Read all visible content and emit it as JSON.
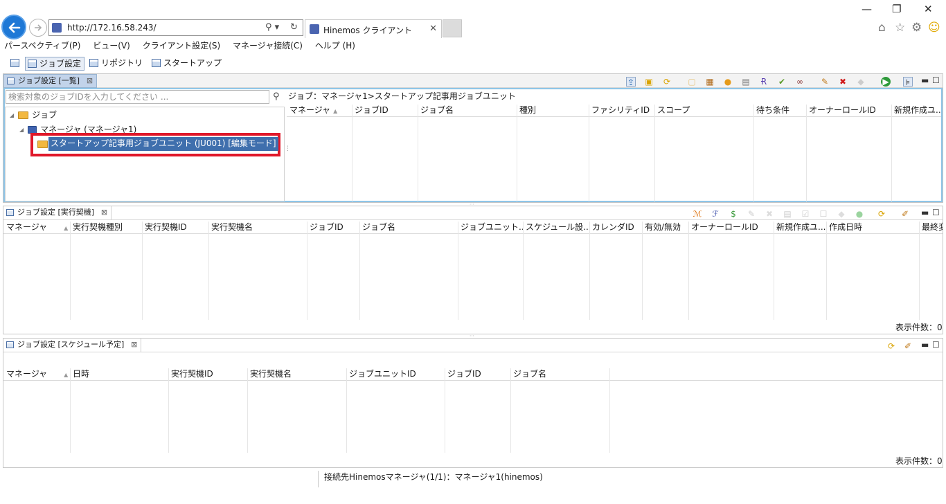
{
  "browser": {
    "url": "http://172.16.58.243/",
    "tab_title": "Hinemos クライアント",
    "search_glyph": "⚲ ▾",
    "refresh_glyph": "↻",
    "tab_close": "✕",
    "minimize": "—",
    "restore": "❐",
    "close": "✕",
    "home_glyph": "⌂",
    "star_glyph": "☆",
    "settings_glyph": "⚙",
    "smiley_glyph": "☺"
  },
  "menu": {
    "items": [
      "パースペクティブ(P)",
      "ビュー(V)",
      "クライアント設定(S)",
      "マネージャ接続(C)",
      "ヘルプ (H)"
    ]
  },
  "perspectives": {
    "items": [
      "ジョブ設定",
      "リポジトリ",
      "スタートアップ"
    ]
  },
  "job_list": {
    "tab_label": "ジョブ設定 [一覧]",
    "search_placeholder": "検索対象のジョブIDを入力してください ...",
    "breadcrumb": "ジョブ：マネージャ1>スタートアップ記事用ジョブユニット",
    "tree": {
      "root": "ジョブ",
      "manager": "マネージャ (マネージャ1)",
      "unit": "スタートアップ記事用ジョブユニット (JU001) [編集モード]"
    },
    "columns": [
      "マネージャ",
      "ジョブID",
      "ジョブ名",
      "種別",
      "ファシリティID",
      "スコープ",
      "待ち条件",
      "オーナーロールID",
      "新規作成ユ..."
    ]
  },
  "trigger": {
    "tab_label": "ジョブ設定 [実行契機]",
    "columns": [
      "マネージャ",
      "実行契機種別",
      "実行契機ID",
      "実行契機名",
      "ジョブID",
      "ジョブ名",
      "ジョブユニット...",
      "スケジュール設...",
      "カレンダID",
      "有効/無効",
      "オーナーロールID",
      "新規作成ユ...",
      "作成日時",
      "最終変"
    ],
    "count": "表示件数：0"
  },
  "schedule": {
    "tab_label": "ジョブ設定 [スケジュール予定]",
    "columns": [
      "マネージャ",
      "日時",
      "実行契機ID",
      "実行契機名",
      "ジョブユニットID",
      "ジョブID",
      "ジョブ名"
    ],
    "count": "表示件数：0"
  },
  "status": {
    "text": "接続先Hinemosマネージャ(1/1)：マネージャ1(hinemos)"
  }
}
